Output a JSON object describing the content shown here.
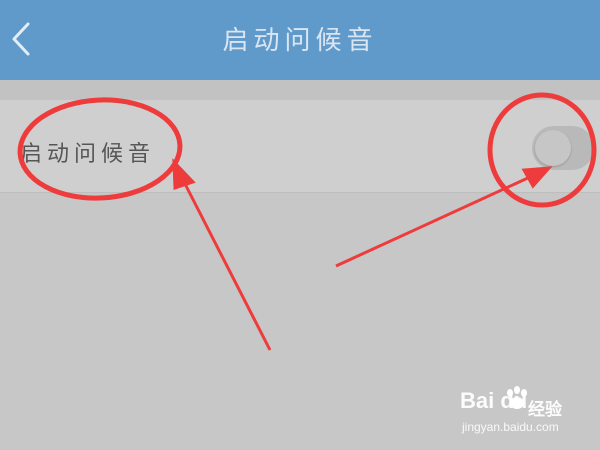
{
  "header": {
    "title": "启动问候音",
    "back_icon": "chevron-left-icon",
    "background_color": "#5f9acb"
  },
  "setting": {
    "label": "启动问候音",
    "toggle": {
      "state": "off"
    }
  },
  "annotation": {
    "color": "#ee3b3b"
  },
  "watermark": {
    "logo": "Bai du",
    "brand_cn": "经验",
    "url": "jingyan.baidu.com"
  }
}
